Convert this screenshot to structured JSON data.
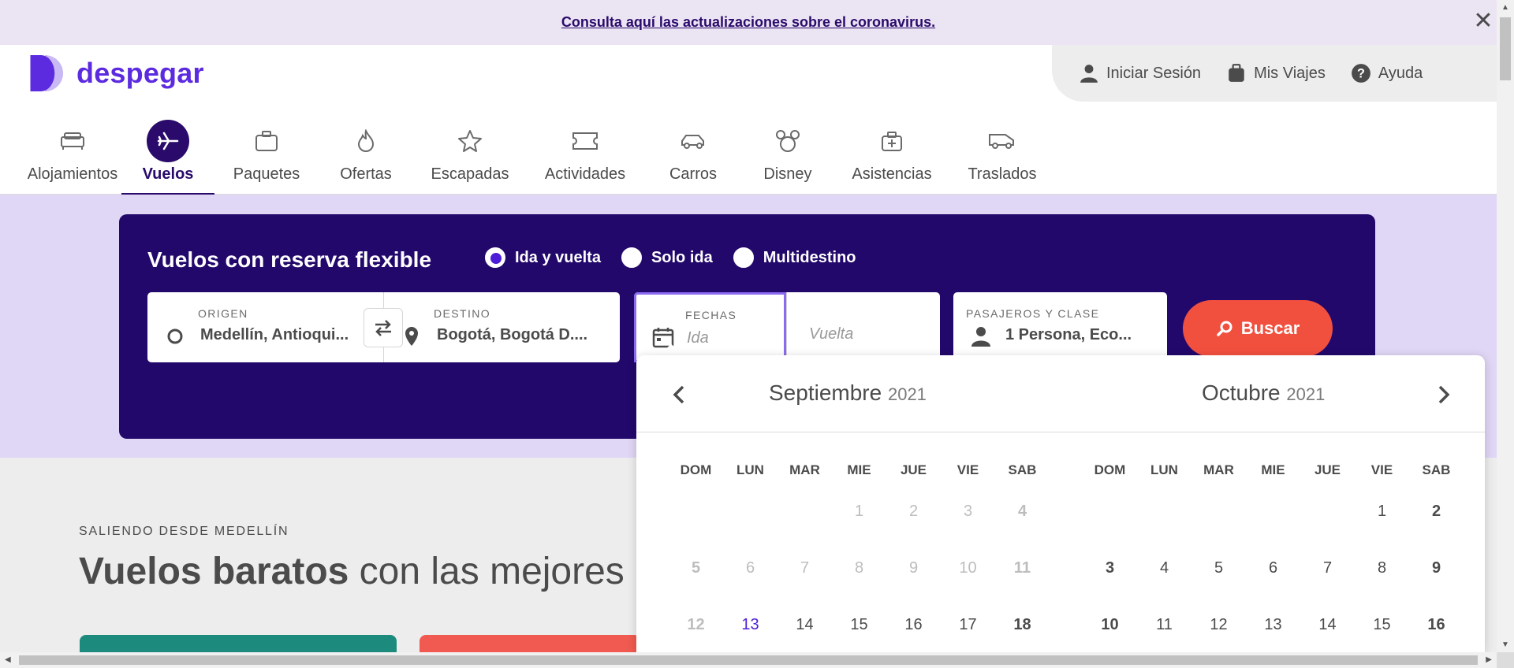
{
  "banner": {
    "text": "Consulta aquí las actualizaciones sobre el coronavirus.",
    "close": "✕"
  },
  "brand": {
    "name": "despegar",
    "color": "#5c2be0"
  },
  "user_menu": {
    "login": "Iniciar Sesión",
    "trips": "Mis Viajes",
    "help": "Ayuda"
  },
  "nav": [
    {
      "label": "Alojamientos",
      "icon": "bed-icon"
    },
    {
      "label": "Vuelos",
      "icon": "plane-icon",
      "active": true
    },
    {
      "label": "Paquetes",
      "icon": "suitcase-icon"
    },
    {
      "label": "Ofertas",
      "icon": "flame-icon"
    },
    {
      "label": "Escapadas",
      "icon": "star-icon"
    },
    {
      "label": "Actividades",
      "icon": "ticket-icon"
    },
    {
      "label": "Carros",
      "icon": "car-icon"
    },
    {
      "label": "Disney",
      "icon": "mickey-icon"
    },
    {
      "label": "Asistencias",
      "icon": "medical-bag-icon"
    },
    {
      "label": "Traslados",
      "icon": "van-icon"
    }
  ],
  "search": {
    "title": "Vuelos con reserva flexible",
    "trip_types": [
      "Ida y vuelta",
      "Solo ida",
      "Multidestino"
    ],
    "origin_label": "ORIGEN",
    "origin_value": "Medellín, Antioqui...",
    "destination_label": "DESTINO",
    "destination_value": "Bogotá, Bogotá D....",
    "dates_label": "FECHAS",
    "ida_placeholder": "Ida",
    "vuelta_placeholder": "Vuelta",
    "pax_label": "PASAJEROS Y CLASE",
    "pax_value": "1 Persona, Eco...",
    "button": "Buscar",
    "accent": "#22086b",
    "button_color": "#f2503f"
  },
  "content": {
    "kicker": "SALIENDO DESDE MEDELLÍN",
    "headline_bold": "Vuelos baratos",
    "headline_rest": " con las mejores a"
  },
  "calendar": {
    "weekdays": [
      "DOM",
      "LUN",
      "MAR",
      "MIE",
      "JUE",
      "VIE",
      "SAB"
    ],
    "months": [
      {
        "name": "Septiembre",
        "year": "2021",
        "weeks": [
          [
            "",
            "",
            "",
            "1",
            "2",
            "3",
            "4"
          ],
          [
            "5",
            "6",
            "7",
            "8",
            "9",
            "10",
            "11"
          ],
          [
            "12",
            "13",
            "14",
            "15",
            "16",
            "17",
            "18"
          ]
        ],
        "disabled_until": 12,
        "today": "13"
      },
      {
        "name": "Octubre",
        "year": "2021",
        "weeks": [
          [
            "",
            "",
            "",
            "",
            "",
            "1",
            "2"
          ],
          [
            "3",
            "4",
            "5",
            "6",
            "7",
            "8",
            "9"
          ],
          [
            "10",
            "11",
            "12",
            "13",
            "14",
            "15",
            "16"
          ]
        ],
        "disabled_until": 0,
        "today": ""
      }
    ]
  }
}
